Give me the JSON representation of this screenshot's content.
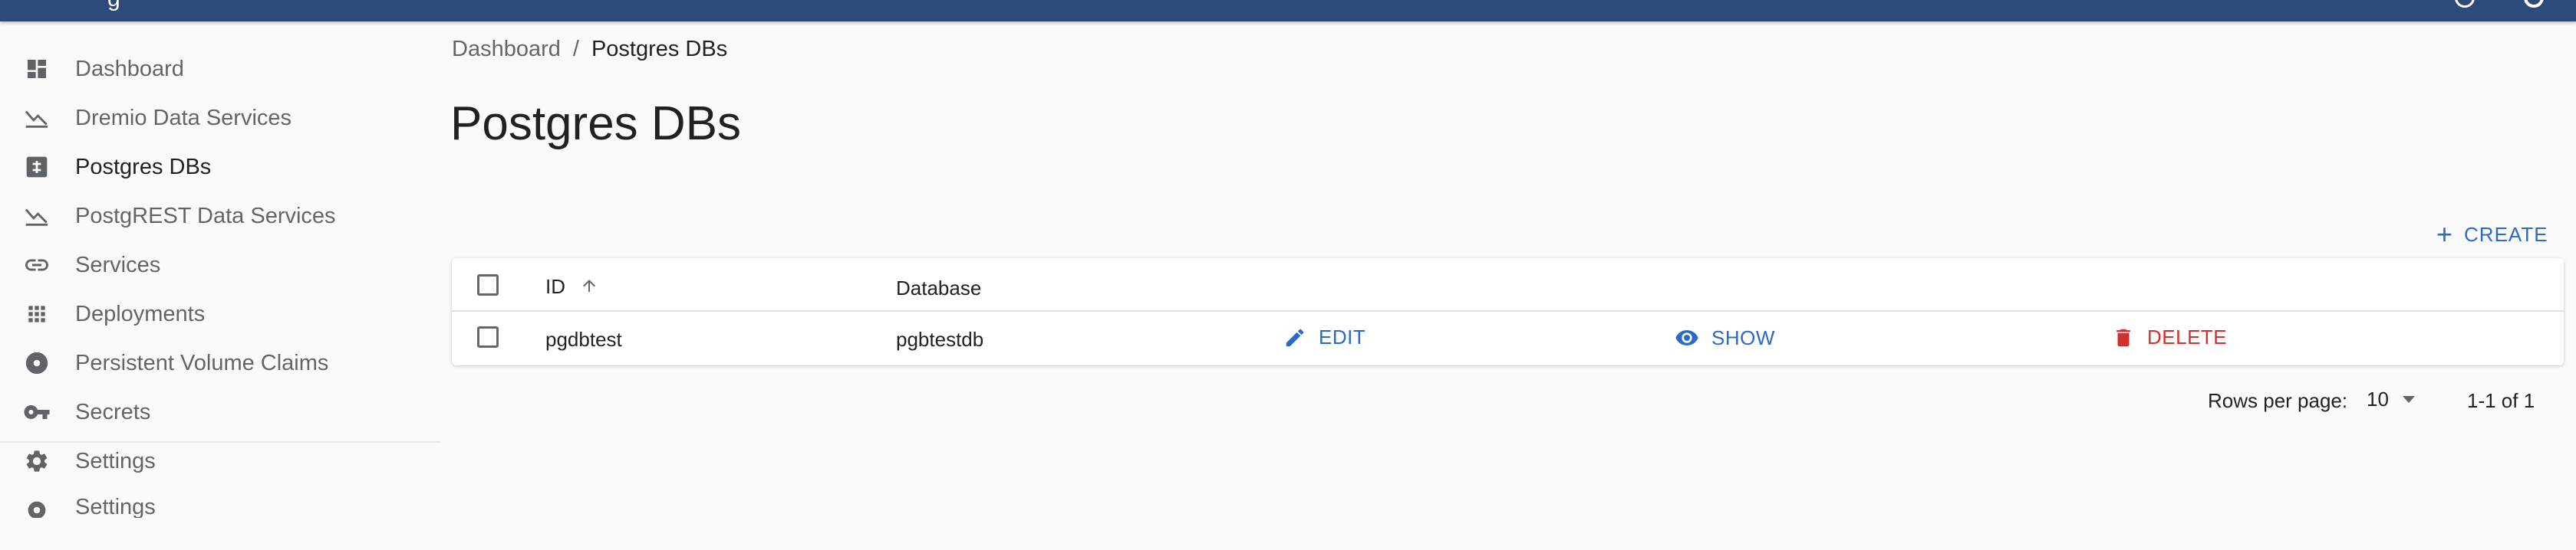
{
  "appbar": {
    "title_fragment": "g"
  },
  "sidebar": {
    "items": [
      {
        "label": "Dashboard",
        "icon": "dashboard-icon"
      },
      {
        "label": "Dremio Data Services",
        "icon": "chart-line-down-icon"
      },
      {
        "label": "Postgres DBs",
        "icon": "grid-table-icon",
        "active": true
      },
      {
        "label": "PostgREST Data Services",
        "icon": "chart-line-down-icon"
      },
      {
        "label": "Services",
        "icon": "link-icon"
      },
      {
        "label": "Deployments",
        "icon": "apps-grid-icon"
      },
      {
        "label": "Persistent Volume Claims",
        "icon": "disc-icon"
      },
      {
        "label": "Secrets",
        "icon": "key-icon"
      },
      {
        "label": "Settings",
        "icon": "gear-icon"
      },
      {
        "label": "Settings",
        "icon": "gear-icon",
        "clipped": true
      }
    ]
  },
  "breadcrumb": {
    "parent": "Dashboard",
    "separator": "/",
    "current": "Postgres DBs"
  },
  "page": {
    "title": "Postgres DBs"
  },
  "toolbar": {
    "create_label": "CREATE"
  },
  "table": {
    "columns": {
      "id": "ID",
      "database": "Database"
    },
    "sort": {
      "column": "ID",
      "direction": "asc"
    },
    "rows": [
      {
        "id": "pgdbtest",
        "database": "pgbtestdb",
        "edit_label": "EDIT",
        "show_label": "SHOW",
        "delete_label": "DELETE"
      }
    ]
  },
  "pagination": {
    "rows_per_page_label": "Rows per page:",
    "rows_per_page": "10",
    "range": "1-1 of 1"
  },
  "colors": {
    "appbar": "#2d4a7a",
    "primary": "#2b6bc3",
    "danger": "#d32f2f"
  }
}
